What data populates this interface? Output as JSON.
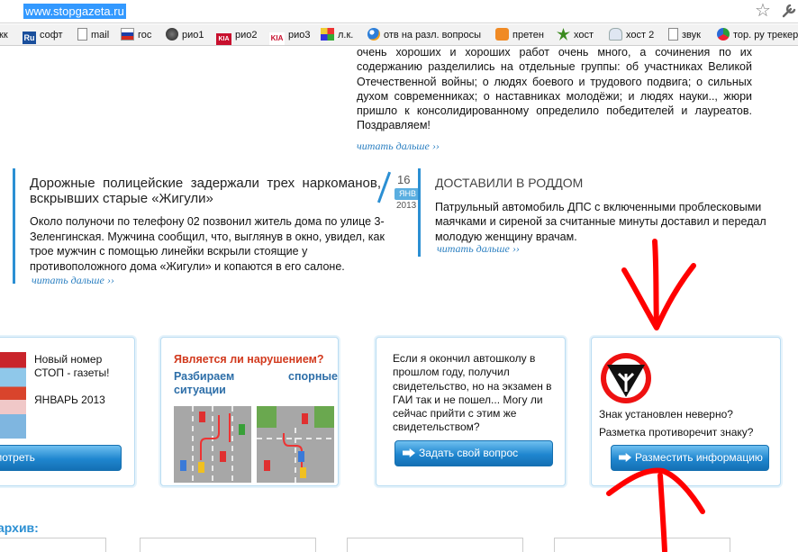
{
  "browser": {
    "url": "www.stopgazeta.ru",
    "bookmarks": [
      {
        "label": "кк",
        "icon": "none"
      },
      {
        "label": "софт",
        "icon": "ru-badge"
      },
      {
        "label": "mail",
        "icon": "page-icon"
      },
      {
        "label": "гос",
        "icon": "russia-flag-icon"
      },
      {
        "label": "рио1",
        "icon": "dark-circle-icon"
      },
      {
        "label": "рио2",
        "icon": "kia-icon"
      },
      {
        "label": "рио3",
        "icon": "kia-icon"
      },
      {
        "label": "л.к.",
        "icon": "colorful-icon"
      },
      {
        "label": "отв на разл. вопросы",
        "icon": "globe-icon"
      },
      {
        "label": "претен",
        "icon": "orange-icon"
      },
      {
        "label": "хост",
        "icon": "leaf-icon"
      },
      {
        "label": "хост 2",
        "icon": "ghost-icon"
      },
      {
        "label": "звук",
        "icon": "page-icon"
      },
      {
        "label": "тор. ру трекер",
        "icon": "bug-icon"
      }
    ]
  },
  "top_article": {
    "lines": [
      "очень хороших и хороших работ очень много, а сочинения по их содержанию разделились на отдельные группы: об участниках Великой Отечественной войны; о людях боевого и трудового подвига; о сильных духом современниках; о наставниках молодёжи; и людях науки.., жюри пришло к консолидированному определило победителей и лауреатов. Поздравляем!"
    ],
    "read_more": "читать дальше ››"
  },
  "news_left": {
    "title": "Дорожные полицейские задержали трех наркоманов, вскрывших старые «Жигули»",
    "body": "Около полуночи по телефону 02 позвонил житель дома по улице 3-Зеленгинская. Мужчина сообщил, что, выглянув в окно, увидел, как трое мужчин с помощью линейки вскрыли стоящие у противоположного дома «Жигули» и копаются в его салоне.",
    "read_more": "читать дальше ››",
    "date_day": "16",
    "date_month": "ЯНВ",
    "date_year": "2013"
  },
  "news_right": {
    "title": "ДОСТАВИЛИ В РОДДОМ",
    "body": "Патрульный автомобиль ДПС с включенными проблесковыми маячками и сиреной за считанные минуты доставил и передал молодую женщину врачам.",
    "read_more": "читать дальше ››"
  },
  "cards": {
    "issue": {
      "text": "Новый номер СТОП - газеты!",
      "month": "ЯНВАРЬ 2013",
      "button": "смотреть"
    },
    "violation": {
      "question": "Является ли нарушением?",
      "sub_a": "Разбираем",
      "sub_b": "спорные",
      "sub_c": "ситуации"
    },
    "ask": {
      "text": "Если я окончил автошколу в прошлом году, получил свидетельство, но на экзамен в ГАИ так и не пошел... Могу ли сейчас прийти с этим же свидетельством?",
      "button": "Задать свой вопрос"
    },
    "sign": {
      "line1": "Знак установлен неверно?",
      "line2": "Разметка противоречит знаку?",
      "button": "Разместить информацию"
    }
  },
  "archive_label": "архив:",
  "colors": {
    "accent": "#2b8fd3",
    "button": "#1f86cf",
    "question": "#d23a1e",
    "annotation": "#ff0000"
  }
}
